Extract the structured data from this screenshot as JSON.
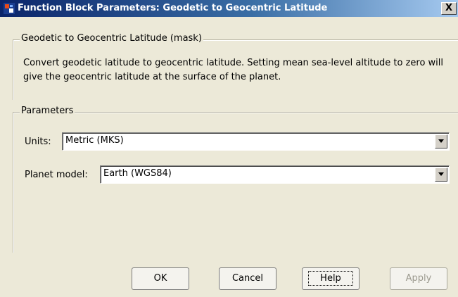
{
  "window": {
    "title": "Function Block Parameters: Geodetic to Geocentric Latitude",
    "close_glyph": "X",
    "app_icon": "simulink-block-icon"
  },
  "mask": {
    "group_label": "Geodetic to Geocentric Latitude (mask)",
    "description": "Convert geodetic latitude to geocentric latitude. Setting mean sea-level altitude to zero will give the geocentric latitude at the surface of the planet."
  },
  "parameters": {
    "group_label": "Parameters",
    "units": {
      "label": "Units:",
      "value": "Metric (MKS)"
    },
    "planet_model": {
      "label": "Planet model:",
      "value": "Earth (WGS84)"
    }
  },
  "buttons": {
    "ok": "OK",
    "cancel": "Cancel",
    "help": "Help",
    "apply": "Apply"
  },
  "colors": {
    "titlebar_start": "#0a246a",
    "titlebar_end": "#a6caf0",
    "dialog_bg": "#ece9d8"
  }
}
